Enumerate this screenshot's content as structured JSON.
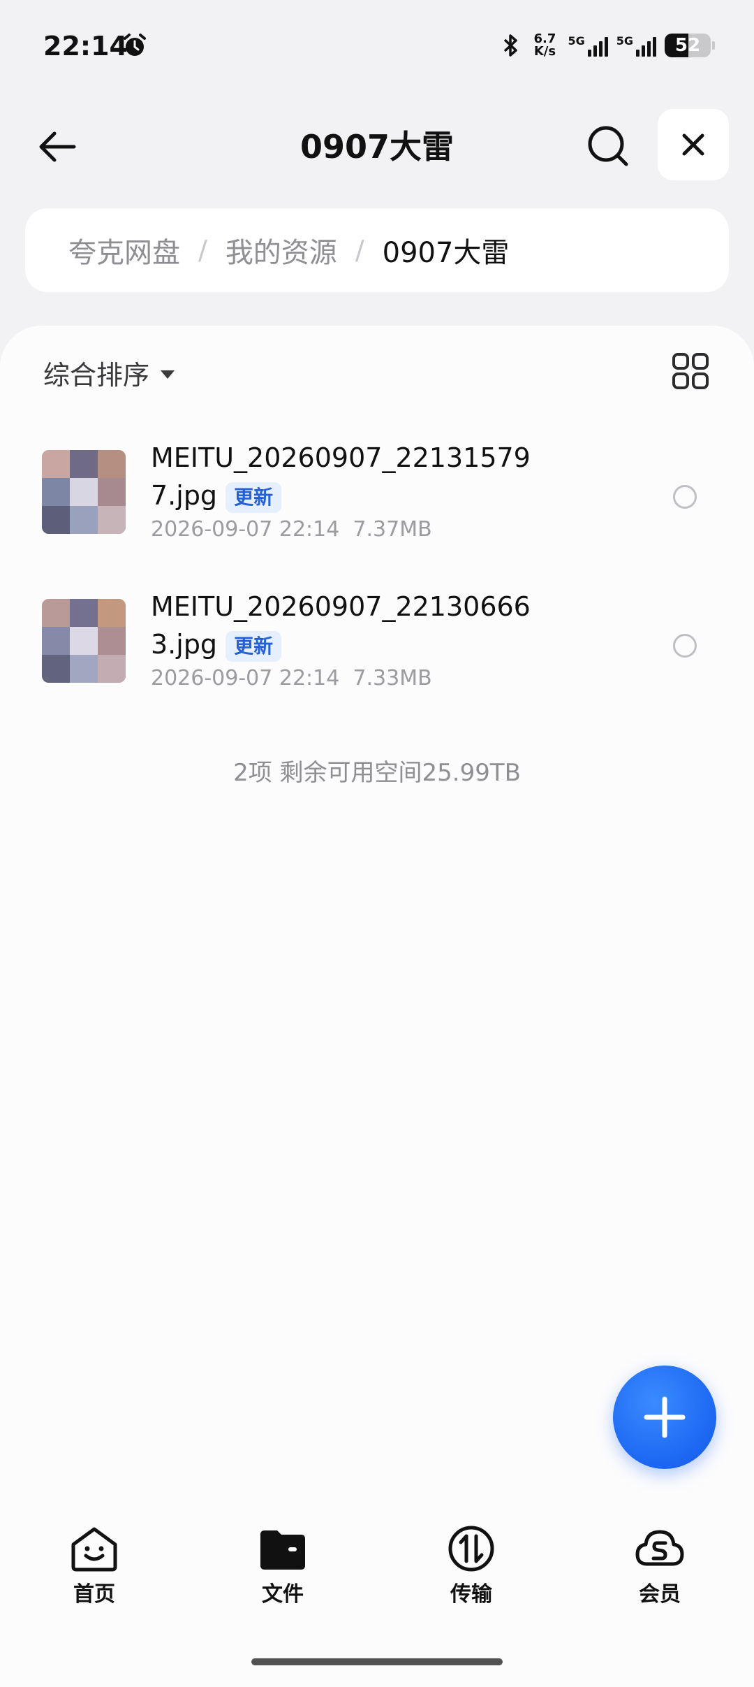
{
  "status_bar": {
    "time": "22:14",
    "net_speed_value": "6.7",
    "net_speed_unit": "K/s",
    "sim1_label": "5G",
    "sim2_label": "5G",
    "battery_percent": "52",
    "battery_level": 0.52
  },
  "header": {
    "title": "0907大雷"
  },
  "breadcrumb": {
    "items": [
      "夸克网盘",
      "我的资源",
      "0907大雷"
    ],
    "separator": "/"
  },
  "toolbar": {
    "sort_label": "综合排序"
  },
  "files": [
    {
      "name": "MEITU_20260907_221315797.jpg",
      "tag": "更新",
      "date": "2026-09-07 22:14",
      "size": "7.37MB"
    },
    {
      "name": "MEITU_20260907_221306663.jpg",
      "tag": "更新",
      "date": "2026-09-07 22:14",
      "size": "7.33MB"
    }
  ],
  "summary": "2项 剩余可用空间25.99TB",
  "bottom_nav": {
    "items": [
      {
        "label": "首页",
        "icon": "home-face-icon"
      },
      {
        "label": "文件",
        "icon": "folder-icon"
      },
      {
        "label": "传输",
        "icon": "transfer-icon"
      },
      {
        "label": "会员",
        "icon": "membership-cloud-icon"
      }
    ],
    "active_index": 1
  },
  "colors": {
    "accent": "#1c66f2",
    "tag_bg": "#e6effd",
    "tag_text": "#2660d6"
  }
}
